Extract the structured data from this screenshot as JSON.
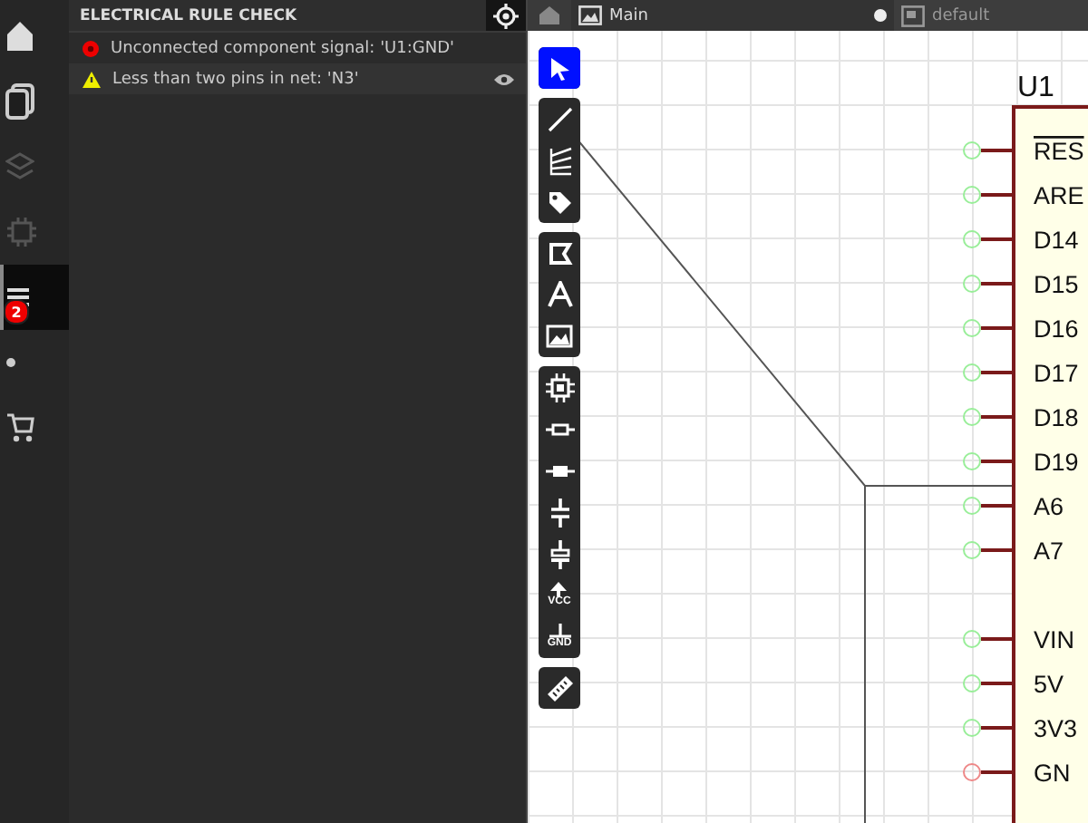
{
  "sidebar": {
    "items": [
      {
        "kind": "home",
        "selected": false
      },
      {
        "kind": "files",
        "selected": false
      },
      {
        "kind": "layers",
        "selected": false
      },
      {
        "kind": "chip",
        "selected": false
      },
      {
        "kind": "list",
        "selected": true,
        "badge": "2"
      },
      {
        "kind": "dot",
        "selected": false
      },
      {
        "kind": "cart",
        "selected": false
      }
    ]
  },
  "erc_panel": {
    "title": "ELECTRICAL RULE CHECK",
    "items": [
      {
        "kind": "error",
        "message": "Unconnected component signal: 'U1:GND'",
        "selected": false
      },
      {
        "kind": "warning",
        "message": "Less than two pins in net: 'N3'",
        "selected": true
      }
    ]
  },
  "tabs": [
    {
      "kind": "sheet",
      "label": "Main",
      "modified": true
    },
    {
      "kind": "variant",
      "label": "default",
      "modified": false
    }
  ],
  "tools": {
    "groups": [
      [
        {
          "kind": "select",
          "selected": true
        }
      ],
      [
        {
          "kind": "wire",
          "selected": false
        },
        {
          "kind": "bus",
          "selected": false
        },
        {
          "kind": "tag",
          "selected": false
        }
      ],
      [
        {
          "kind": "polygon",
          "selected": false
        },
        {
          "kind": "text",
          "selected": false
        },
        {
          "kind": "image",
          "selected": false
        }
      ],
      [
        {
          "kind": "chip",
          "selected": false
        },
        {
          "kind": "resistor",
          "selected": false
        },
        {
          "kind": "resistor-filled",
          "selected": false
        },
        {
          "kind": "capacitor",
          "selected": false
        },
        {
          "kind": "polar-capacitor",
          "selected": false
        },
        {
          "kind": "power",
          "label": "VCC",
          "selected": false
        },
        {
          "kind": "ground",
          "label": "GND",
          "selected": false
        }
      ],
      [
        {
          "kind": "ruler",
          "selected": false
        }
      ]
    ]
  },
  "schematic": {
    "component": {
      "ref": "U1",
      "pins": [
        {
          "kind": "pin",
          "name": "RES",
          "overline": true,
          "connected": true
        },
        {
          "kind": "pin",
          "name": "ARE",
          "overline": false,
          "connected": true
        },
        {
          "kind": "pin",
          "name": "D14",
          "overline": false,
          "connected": true
        },
        {
          "kind": "pin",
          "name": "D15",
          "overline": false,
          "connected": true
        },
        {
          "kind": "pin",
          "name": "D16",
          "overline": false,
          "connected": true
        },
        {
          "kind": "pin",
          "name": "D17",
          "overline": false,
          "connected": true
        },
        {
          "kind": "pin",
          "name": "D18",
          "overline": false,
          "connected": true
        },
        {
          "kind": "pin",
          "name": "D19",
          "overline": false,
          "connected": true
        },
        {
          "kind": "pin",
          "name": "A6",
          "overline": false,
          "connected": true
        },
        {
          "kind": "pin",
          "name": "A7",
          "overline": false,
          "connected": true
        },
        {
          "kind": "gap"
        },
        {
          "kind": "pin",
          "name": "VIN",
          "overline": false,
          "connected": true
        },
        {
          "kind": "pin",
          "name": "5V",
          "overline": false,
          "connected": true
        },
        {
          "kind": "pin",
          "name": "3V3",
          "overline": false,
          "connected": true
        },
        {
          "kind": "pin",
          "name": "GN",
          "overline": false,
          "connected": false
        }
      ]
    }
  }
}
